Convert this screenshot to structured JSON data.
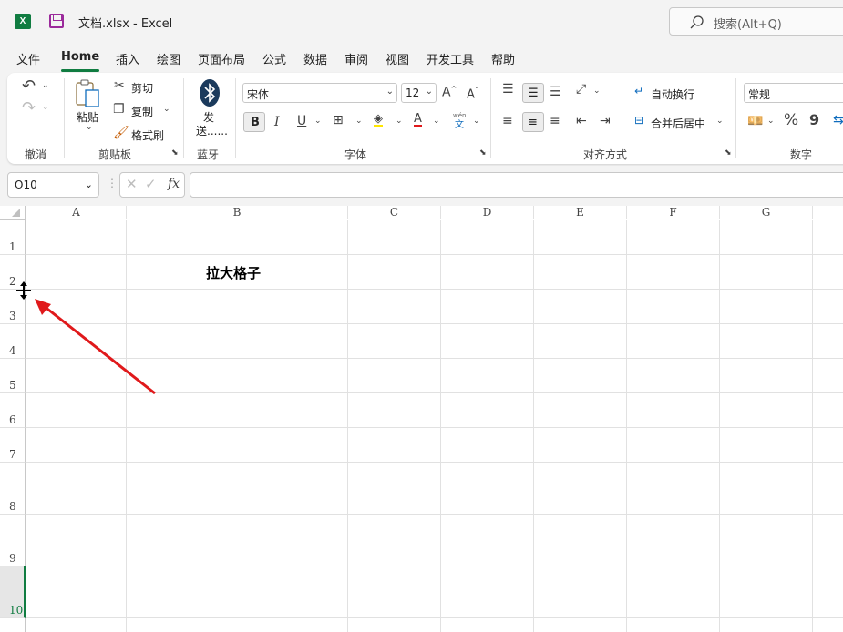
{
  "app": {
    "logo": "X",
    "title": "文档.xlsx  -  Excel",
    "search_placeholder": "搜索(Alt+Q)"
  },
  "tabs": [
    {
      "label": "文件"
    },
    {
      "label": "Home",
      "active": true
    },
    {
      "label": "插入"
    },
    {
      "label": "绘图"
    },
    {
      "label": "页面布局"
    },
    {
      "label": "公式"
    },
    {
      "label": "数据"
    },
    {
      "label": "审阅"
    },
    {
      "label": "视图"
    },
    {
      "label": "开发工具"
    },
    {
      "label": "帮助"
    }
  ],
  "ribbon": {
    "undo_group": "撤消",
    "clipboard": {
      "paste": "粘贴",
      "cut": "剪切",
      "copy": "复制",
      "format_painter": "格式刷",
      "group": "剪贴板"
    },
    "bluetooth": {
      "send1": "发",
      "send2": "送......",
      "group": "蓝牙"
    },
    "font": {
      "name": "宋体",
      "size": "12",
      "group": "字体",
      "bold": "B",
      "italic": "I",
      "underline": "U",
      "phonetic_top": "wén",
      "phonetic_bottom": "文"
    },
    "alignment": {
      "wrap": "自动换行",
      "merge": "合并后居中",
      "group": "对齐方式"
    },
    "number": {
      "format": "常规",
      "group": "数字",
      "percent": "%",
      "comma": "9"
    }
  },
  "formula_bar": {
    "name_box": "O10",
    "fx": "fx",
    "value": ""
  },
  "sheet": {
    "columns": [
      "A",
      "B",
      "C",
      "D",
      "E",
      "F",
      "G"
    ],
    "rows": [
      "1",
      "2",
      "3",
      "4",
      "5",
      "6",
      "7",
      "8",
      "9",
      "10"
    ],
    "selected_row": "10",
    "cells": {
      "B2": "拉大格子"
    }
  },
  "colors": {
    "accent": "#107c41",
    "arrow": "#e0191b"
  }
}
